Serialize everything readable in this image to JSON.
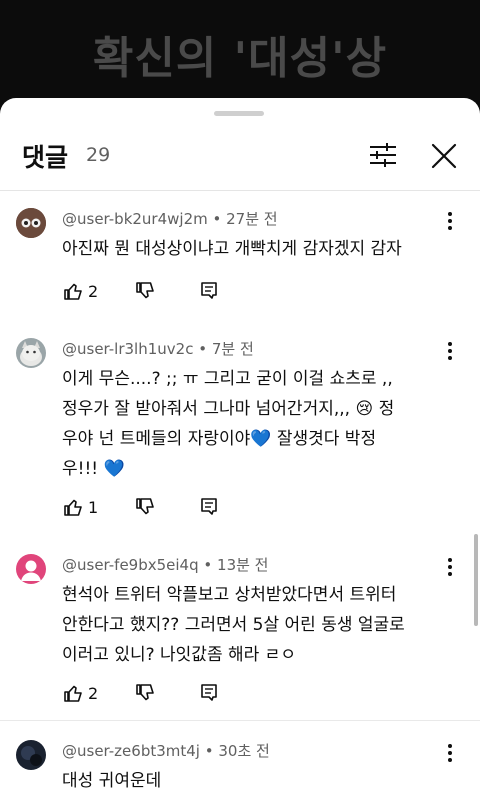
{
  "video": {
    "title": "확신의 '대성'상"
  },
  "panel": {
    "title": "댓글",
    "count": "29"
  },
  "comments": [
    {
      "author": "@user-bk2ur4wj2m",
      "time": "27분 전",
      "text": "아진짜 뭔 대성상이냐고 개빡치게 감자겠지 감자",
      "likes": "2"
    },
    {
      "author": "@user-lr3lh1uv2c",
      "time": "7분 전",
      "text_lines": [
        "이게 무슨....? ;;  ㅠ 그리고 굳이 이걸 쇼츠로 ,,",
        "정우가 잘 받아줘서 그나마 넘어간거지,,,",
        "우야 넌 트메들의 자랑이야",
        "우!!!"
      ],
      "text_tail_1": "정",
      "text_tail_2": "잘생겻다 박정",
      "emoji_1": "😢",
      "emoji_2": "💙",
      "emoji_3": "💙",
      "likes": "1"
    },
    {
      "author": "@user-fe9bx5ei4q",
      "time": "13분 전",
      "text": "현석아 트위터 악플보고 상처받았다면서 트위터 안한다고 했지?? 그러면서 5살 어린 동생 얼굴로 이러고 있니? 나잇값좀 해라 ㄹㅇ",
      "likes": "2"
    },
    {
      "author": "@user-ze6bt3mt4j",
      "time": "30초 전",
      "text": "대성 귀여운데"
    }
  ],
  "colors": {
    "sheet_bg": "#ffffff",
    "text_primary": "#0f0f0f",
    "text_secondary": "#606060",
    "avatar_pink": "#e0457b",
    "heart_blue": "#61c4f0"
  },
  "icons": {
    "filter": "sliders-icon",
    "close": "close-icon",
    "like": "thumbs-up-icon",
    "dislike": "thumbs-down-icon",
    "reply": "reply-icon",
    "more": "more-vert-icon"
  }
}
